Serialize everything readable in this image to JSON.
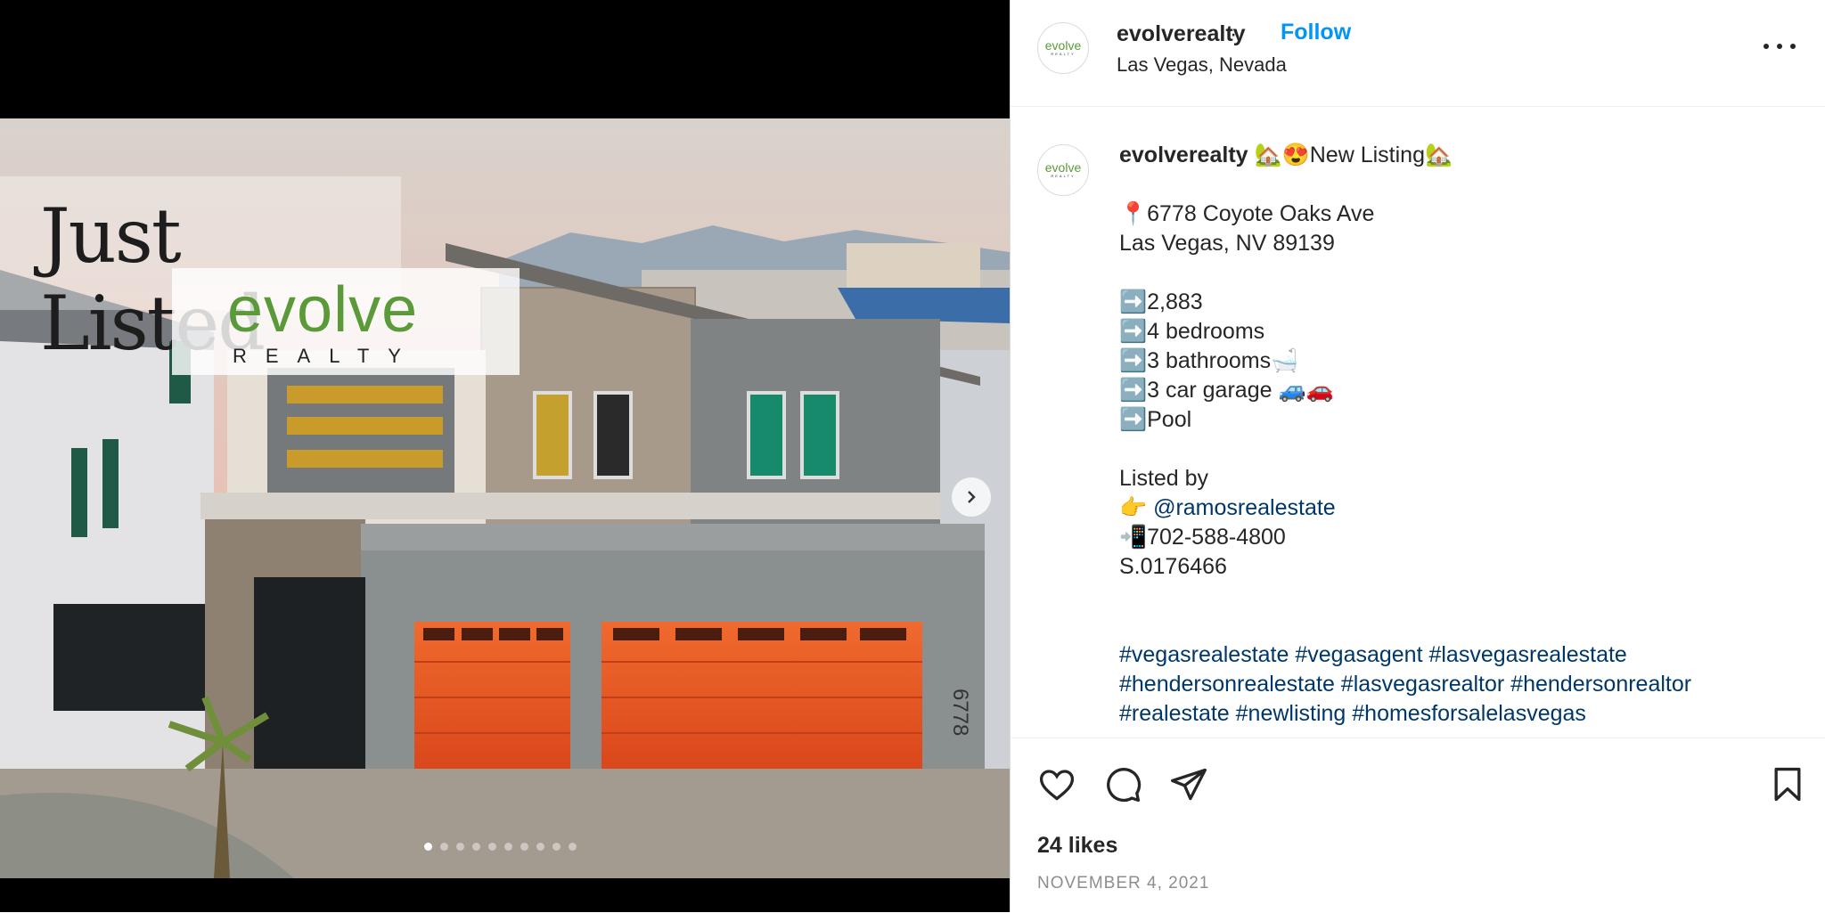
{
  "post": {
    "username": "evolverealty",
    "follow_label": "Follow",
    "location": "Las Vegas, Nevada",
    "avatar_logo": {
      "word": "evolve",
      "sub": "REALTY"
    }
  },
  "image": {
    "overlay_title": "Just Listed",
    "logo_word": "evolve",
    "logo_sub": "REALTY",
    "house_number": "6778",
    "carousel": {
      "total": 10,
      "active": 1
    }
  },
  "caption": {
    "author": "evolverealty",
    "headline": "🏡😍New Listing🏡",
    "address_line1": "📍6778 Coyote Oaks Ave",
    "address_line2": "Las Vegas, NV 89139",
    "features": [
      "➡️2,883",
      "➡️4 bedrooms",
      "➡️3 bathrooms🛁",
      "➡️3 car garage 🚙🚗",
      "➡️Pool"
    ],
    "listed_by": "Listed by",
    "agent_prefix": "👉 ",
    "agent": "@ramosrealestate",
    "phone": "📲702-588-4800",
    "license": "S.0176466",
    "hashtags": [
      "#vegasrealestate #vegasagent #lasvegasrealestate",
      "#hendersonrealestate #lasvegasrealtor #hendersonrealtor",
      "#realestate #newlisting #homesforsalelasvegas"
    ]
  },
  "footer": {
    "likes": "24 likes",
    "date": "NOVEMBER 4, 2021"
  },
  "colors": {
    "accent": "#0095f6",
    "link": "#00376b",
    "brand_green": "#5a9a38",
    "garage_orange": "#e8501f",
    "muted": "#8e8e8e"
  },
  "icons": [
    "heart-icon",
    "comment-icon",
    "share-icon",
    "bookmark-icon",
    "more-icon",
    "chevron-right-icon"
  ]
}
